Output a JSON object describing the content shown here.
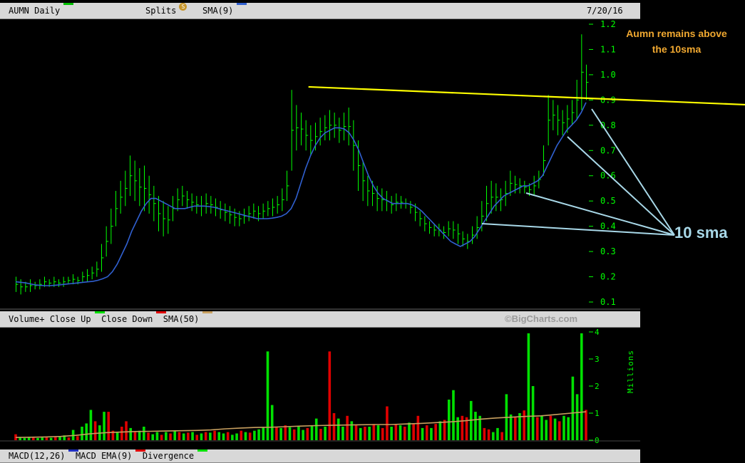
{
  "price_header": {
    "symbol": "AUMN Daily",
    "splits_label": "Splits",
    "split_badge": "S",
    "sma_label": "SMA(9)",
    "date": "7/20/16"
  },
  "volume_header": {
    "volume_label": "Volume+",
    "close_up_label": "Close Up",
    "close_down_label": "Close Down",
    "sma_label": "SMA(50)"
  },
  "macd_header": {
    "macd_label": "MACD(12,26)",
    "macd_ema_label": "MACD EMA(9)",
    "divergence_label": "Divergence"
  },
  "watermark": "©BigCharts.com",
  "annotations": {
    "title_line1": "Aumn remains above",
    "title_line2": "the 10sma",
    "sma_callout": "10 sma"
  },
  "volume_axis_label": "Millions",
  "colors": {
    "price_bar": "#00ff00",
    "sma_line": "#3060d0",
    "vol_up": "#00e000",
    "vol_down": "#e00000",
    "vol_sma": "#c8a060",
    "trendline": "#ffff00",
    "callout_lines": "#a8d8e8",
    "annotation_title": "#f0a830"
  },
  "chart_data": [
    {
      "type": "line",
      "panel": "price",
      "y_ticks": [
        0.1,
        0.2,
        0.3,
        0.4,
        0.5,
        0.6,
        0.7,
        0.8,
        0.9,
        1.0,
        1.1,
        1.2
      ],
      "ylim": [
        0.1,
        1.2
      ],
      "n_bars": 160,
      "series": [
        {
          "name": "SMA(9)",
          "values": [
            0.18,
            0.178,
            0.176,
            0.172,
            0.168,
            0.166,
            0.165,
            0.165,
            0.166,
            0.168,
            0.17,
            0.172,
            0.174,
            0.176,
            0.178,
            0.18,
            0.182,
            0.186,
            0.192,
            0.2,
            0.22,
            0.25,
            0.29,
            0.33,
            0.38,
            0.42,
            0.46,
            0.49,
            0.51,
            0.51,
            0.5,
            0.49,
            0.48,
            0.47,
            0.47,
            0.47,
            0.475,
            0.48,
            0.48,
            0.48,
            0.478,
            0.475,
            0.47,
            0.465,
            0.46,
            0.455,
            0.45,
            0.445,
            0.44,
            0.435,
            0.43,
            0.43,
            0.43,
            0.432,
            0.435,
            0.44,
            0.45,
            0.47,
            0.51,
            0.57,
            0.63,
            0.68,
            0.72,
            0.75,
            0.77,
            0.78,
            0.79,
            0.79,
            0.785,
            0.77,
            0.74,
            0.7,
            0.65,
            0.6,
            0.56,
            0.53,
            0.51,
            0.5,
            0.49,
            0.49,
            0.49,
            0.49,
            0.485,
            0.475,
            0.46,
            0.44,
            0.42,
            0.4,
            0.38,
            0.36,
            0.34,
            0.33,
            0.32,
            0.33,
            0.34,
            0.36,
            0.39,
            0.42,
            0.45,
            0.48,
            0.5,
            0.52,
            0.53,
            0.54,
            0.55,
            0.56,
            0.56,
            0.57,
            0.58,
            0.6,
            0.64,
            0.68,
            0.72,
            0.75,
            0.78,
            0.8,
            0.82,
            0.85,
            0.89
          ],
          "values_note": ""
        },
        {
          "name": "Trendline",
          "values": [
            0.95,
            0.9
          ]
        }
      ],
      "trendline": {
        "from": {
          "bar": 61,
          "value": 0.952
        },
        "to": {
          "bar": 154,
          "value": 0.898
        }
      },
      "price_bars": [
        [
          0.14,
          0.2
        ],
        [
          0.13,
          0.19
        ],
        [
          0.14,
          0.18
        ],
        [
          0.14,
          0.19
        ],
        [
          0.15,
          0.18
        ],
        [
          0.15,
          0.19
        ],
        [
          0.16,
          0.2
        ],
        [
          0.16,
          0.19
        ],
        [
          0.16,
          0.2
        ],
        [
          0.16,
          0.19
        ],
        [
          0.16,
          0.2
        ],
        [
          0.17,
          0.2
        ],
        [
          0.17,
          0.21
        ],
        [
          0.17,
          0.2
        ],
        [
          0.18,
          0.22
        ],
        [
          0.18,
          0.23
        ],
        [
          0.19,
          0.24
        ],
        [
          0.2,
          0.26
        ],
        [
          0.22,
          0.33
        ],
        [
          0.28,
          0.4
        ],
        [
          0.33,
          0.47
        ],
        [
          0.4,
          0.54
        ],
        [
          0.45,
          0.58
        ],
        [
          0.48,
          0.62
        ],
        [
          0.52,
          0.68
        ],
        [
          0.5,
          0.66
        ],
        [
          0.48,
          0.63
        ],
        [
          0.46,
          0.64
        ],
        [
          0.45,
          0.6
        ],
        [
          0.42,
          0.56
        ],
        [
          0.38,
          0.52
        ],
        [
          0.36,
          0.5
        ],
        [
          0.37,
          0.48
        ],
        [
          0.42,
          0.52
        ],
        [
          0.46,
          0.55
        ],
        [
          0.48,
          0.56
        ],
        [
          0.47,
          0.54
        ],
        [
          0.46,
          0.53
        ],
        [
          0.45,
          0.52
        ],
        [
          0.44,
          0.52
        ],
        [
          0.45,
          0.53
        ],
        [
          0.45,
          0.52
        ],
        [
          0.44,
          0.51
        ],
        [
          0.43,
          0.5
        ],
        [
          0.42,
          0.49
        ],
        [
          0.41,
          0.48
        ],
        [
          0.4,
          0.47
        ],
        [
          0.4,
          0.46
        ],
        [
          0.41,
          0.47
        ],
        [
          0.42,
          0.48
        ],
        [
          0.43,
          0.49
        ],
        [
          0.42,
          0.48
        ],
        [
          0.43,
          0.49
        ],
        [
          0.44,
          0.5
        ],
        [
          0.44,
          0.51
        ],
        [
          0.45,
          0.52
        ],
        [
          0.46,
          0.55
        ],
        [
          0.5,
          0.62
        ],
        [
          0.62,
          0.94
        ],
        [
          0.7,
          0.88
        ],
        [
          0.72,
          0.85
        ],
        [
          0.7,
          0.82
        ],
        [
          0.68,
          0.8
        ],
        [
          0.7,
          0.81
        ],
        [
          0.72,
          0.83
        ],
        [
          0.74,
          0.84
        ],
        [
          0.74,
          0.86
        ],
        [
          0.75,
          0.85
        ],
        [
          0.73,
          0.83
        ],
        [
          0.74,
          0.85
        ],
        [
          0.72,
          0.87
        ],
        [
          0.62,
          0.82
        ],
        [
          0.54,
          0.74
        ],
        [
          0.5,
          0.66
        ],
        [
          0.48,
          0.6
        ],
        [
          0.48,
          0.58
        ],
        [
          0.46,
          0.56
        ],
        [
          0.46,
          0.55
        ],
        [
          0.46,
          0.54
        ],
        [
          0.45,
          0.52
        ],
        [
          0.46,
          0.53
        ],
        [
          0.47,
          0.52
        ],
        [
          0.47,
          0.51
        ],
        [
          0.45,
          0.5
        ],
        [
          0.42,
          0.49
        ],
        [
          0.4,
          0.46
        ],
        [
          0.38,
          0.44
        ],
        [
          0.37,
          0.42
        ],
        [
          0.36,
          0.41
        ],
        [
          0.36,
          0.41
        ],
        [
          0.35,
          0.4
        ],
        [
          0.36,
          0.42
        ],
        [
          0.35,
          0.42
        ],
        [
          0.33,
          0.41
        ],
        [
          0.32,
          0.38
        ],
        [
          0.31,
          0.37
        ],
        [
          0.33,
          0.4
        ],
        [
          0.35,
          0.44
        ],
        [
          0.38,
          0.5
        ],
        [
          0.42,
          0.56
        ],
        [
          0.45,
          0.58
        ],
        [
          0.46,
          0.57
        ],
        [
          0.46,
          0.55
        ],
        [
          0.48,
          0.58
        ],
        [
          0.52,
          0.62
        ],
        [
          0.53,
          0.6
        ],
        [
          0.53,
          0.59
        ],
        [
          0.53,
          0.58
        ],
        [
          0.52,
          0.57
        ],
        [
          0.52,
          0.6
        ],
        [
          0.55,
          0.62
        ],
        [
          0.6,
          0.72
        ],
        [
          0.72,
          0.92
        ],
        [
          0.78,
          0.9
        ],
        [
          0.76,
          0.88
        ],
        [
          0.76,
          0.86
        ],
        [
          0.77,
          0.88
        ],
        [
          0.8,
          0.9
        ],
        [
          0.82,
          0.98
        ],
        [
          0.86,
          1.16
        ],
        [
          0.9,
          1.04
        ]
      ]
    },
    {
      "type": "bar",
      "panel": "volume",
      "y_ticks": [
        0,
        1,
        2,
        3,
        4
      ],
      "ylim": [
        0,
        4
      ],
      "unit": "Millions",
      "series": [
        {
          "name": "Close Up"
        },
        {
          "name": "Close Down"
        },
        {
          "name": "SMA(50)"
        }
      ],
      "volume_bars": [
        [
          0.22,
          "d"
        ],
        [
          0.12,
          "u"
        ],
        [
          0.08,
          "u"
        ],
        [
          0.1,
          "u"
        ],
        [
          0.12,
          "d"
        ],
        [
          0.08,
          "u"
        ],
        [
          0.1,
          "u"
        ],
        [
          0.12,
          "d"
        ],
        [
          0.09,
          "u"
        ],
        [
          0.14,
          "d"
        ],
        [
          0.12,
          "u"
        ],
        [
          0.18,
          "u"
        ],
        [
          0.1,
          "d"
        ],
        [
          0.38,
          "u"
        ],
        [
          0.15,
          "d"
        ],
        [
          0.5,
          "u"
        ],
        [
          0.62,
          "u"
        ],
        [
          1.12,
          "u"
        ],
        [
          0.7,
          "d"
        ],
        [
          0.55,
          "u"
        ],
        [
          1.05,
          "u"
        ],
        [
          1.05,
          "d"
        ],
        [
          0.35,
          "d"
        ],
        [
          0.3,
          "u"
        ],
        [
          0.5,
          "d"
        ],
        [
          0.7,
          "d"
        ],
        [
          0.45,
          "u"
        ],
        [
          0.3,
          "d"
        ],
        [
          0.35,
          "u"
        ],
        [
          0.5,
          "u"
        ],
        [
          0.28,
          "d"
        ],
        [
          0.22,
          "u"
        ],
        [
          0.3,
          "u"
        ],
        [
          0.2,
          "d"
        ],
        [
          0.3,
          "u"
        ],
        [
          0.25,
          "d"
        ],
        [
          0.35,
          "u"
        ],
        [
          0.3,
          "d"
        ],
        [
          0.25,
          "u"
        ],
        [
          0.28,
          "d"
        ],
        [
          0.3,
          "u"
        ],
        [
          0.2,
          "d"
        ],
        [
          0.25,
          "u"
        ],
        [
          0.3,
          "d"
        ],
        [
          0.28,
          "u"
        ],
        [
          0.35,
          "d"
        ],
        [
          0.3,
          "u"
        ],
        [
          0.25,
          "u"
        ],
        [
          0.3,
          "d"
        ],
        [
          0.2,
          "u"
        ],
        [
          0.25,
          "u"
        ],
        [
          0.35,
          "d"
        ],
        [
          0.3,
          "u"
        ],
        [
          0.28,
          "d"
        ],
        [
          0.35,
          "u"
        ],
        [
          0.4,
          "u"
        ],
        [
          0.48,
          "u"
        ],
        [
          3.28,
          "u"
        ],
        [
          1.3,
          "u"
        ],
        [
          0.48,
          "d"
        ],
        [
          0.45,
          "u"
        ],
        [
          0.55,
          "d"
        ],
        [
          0.48,
          "u"
        ],
        [
          0.4,
          "d"
        ],
        [
          0.5,
          "u"
        ],
        [
          0.38,
          "u"
        ],
        [
          0.45,
          "d"
        ],
        [
          0.55,
          "u"
        ],
        [
          0.8,
          "u"
        ],
        [
          0.42,
          "d"
        ],
        [
          0.5,
          "u"
        ],
        [
          3.28,
          "d"
        ],
        [
          1.0,
          "d"
        ],
        [
          0.8,
          "u"
        ],
        [
          0.5,
          "u"
        ],
        [
          0.9,
          "d"
        ],
        [
          0.7,
          "u"
        ],
        [
          0.55,
          "d"
        ],
        [
          0.45,
          "u"
        ],
        [
          0.5,
          "d"
        ],
        [
          0.5,
          "u"
        ],
        [
          0.6,
          "d"
        ],
        [
          0.55,
          "u"
        ],
        [
          0.45,
          "d"
        ],
        [
          1.25,
          "d"
        ],
        [
          0.5,
          "u"
        ],
        [
          0.6,
          "d"
        ],
        [
          0.55,
          "u"
        ],
        [
          0.5,
          "d"
        ],
        [
          0.65,
          "u"
        ],
        [
          0.6,
          "d"
        ],
        [
          0.9,
          "d"
        ],
        [
          0.45,
          "u"
        ],
        [
          0.55,
          "d"
        ],
        [
          0.45,
          "u"
        ],
        [
          0.6,
          "d"
        ],
        [
          0.7,
          "u"
        ],
        [
          0.75,
          "d"
        ],
        [
          1.5,
          "u"
        ],
        [
          1.85,
          "u"
        ],
        [
          0.85,
          "u"
        ],
        [
          0.9,
          "d"
        ],
        [
          0.85,
          "d"
        ],
        [
          1.45,
          "u"
        ],
        [
          1.05,
          "u"
        ],
        [
          0.9,
          "u"
        ],
        [
          0.45,
          "d"
        ],
        [
          0.4,
          "d"
        ],
        [
          0.3,
          "u"
        ],
        [
          0.45,
          "u"
        ],
        [
          0.3,
          "d"
        ],
        [
          1.7,
          "u"
        ],
        [
          0.95,
          "u"
        ],
        [
          0.85,
          "d"
        ],
        [
          1.0,
          "u"
        ],
        [
          1.1,
          "d"
        ],
        [
          3.95,
          "u"
        ],
        [
          2.0,
          "u"
        ],
        [
          0.85,
          "d"
        ],
        [
          0.9,
          "u"
        ],
        [
          0.75,
          "u"
        ],
        [
          0.9,
          "d"
        ],
        [
          0.8,
          "u"
        ],
        [
          0.7,
          "d"
        ],
        [
          0.9,
          "u"
        ],
        [
          0.85,
          "u"
        ],
        [
          2.35,
          "u"
        ],
        [
          1.7,
          "u"
        ],
        [
          3.95,
          "u"
        ],
        [
          1.12,
          "d"
        ]
      ],
      "sma50": [
        0.1,
        0.11,
        0.12,
        0.14,
        0.18,
        0.24,
        0.28,
        0.3,
        0.32,
        0.33,
        0.34,
        0.35,
        0.36,
        0.38,
        0.42,
        0.45,
        0.47,
        0.48,
        0.5,
        0.52,
        0.54,
        0.55,
        0.56,
        0.57,
        0.58,
        0.58,
        0.6,
        0.62,
        0.65,
        0.68,
        0.72,
        0.78,
        0.82,
        0.85,
        0.88,
        0.9,
        0.95,
        1.0,
        1.05
      ]
    }
  ]
}
